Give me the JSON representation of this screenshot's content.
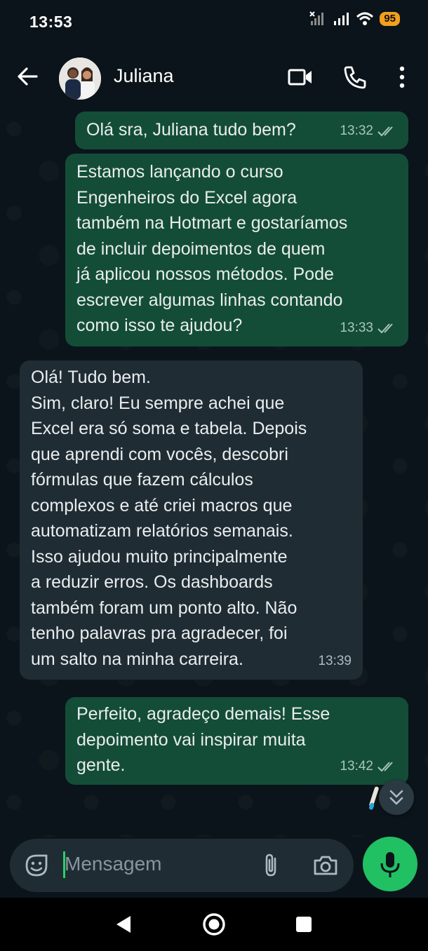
{
  "status_bar": {
    "time": "13:53",
    "battery": "95"
  },
  "header": {
    "contact_name": "Juliana",
    "icons": [
      "back-arrow-icon",
      "video-call-icon",
      "phone-icon",
      "more-vert-icon"
    ]
  },
  "messages": [
    {
      "direction": "outgoing",
      "text": "Olá sra,  Juliana tudo bem?",
      "time": "13:32",
      "read": true
    },
    {
      "direction": "outgoing",
      "text": "Estamos lançando o curso\nEngenheiros do Excel agora\ntambém na Hotmart e gostaríamos\nde incluir depoimentos de quem\njá aplicou nossos métodos. Pode\nescrever algumas linhas contando\ncomo isso te ajudou?",
      "time": "13:33",
      "read": true
    },
    {
      "direction": "incoming",
      "text": "Olá! Tudo bem.\nSim, claro! Eu sempre achei que\nExcel era só soma e tabela. Depois\nque aprendi com vocês, descobri\nfórmulas que fazem cálculos\ncomplexos e até criei macros que\nautomatizam relatórios semanais.\nIsso ajudou muito principalmente\na reduzir erros. Os dashboards\ntambém foram um ponto alto. Não\ntenho palavras pra agradecer, foi\num salto na minha carreira.",
      "time": "13:39"
    },
    {
      "direction": "outgoing",
      "text": "Perfeito, agradeço demais! Esse\ndepoimento vai inspirar muita\ngente.",
      "time": "13:42",
      "read": true
    }
  ],
  "composer": {
    "placeholder": "Mensagem"
  },
  "colors": {
    "background": "#0b141a",
    "outgoing_bubble": "#144d37",
    "incoming_bubble": "#202c33",
    "accent": "#21c063",
    "battery": "#f2a01d"
  }
}
